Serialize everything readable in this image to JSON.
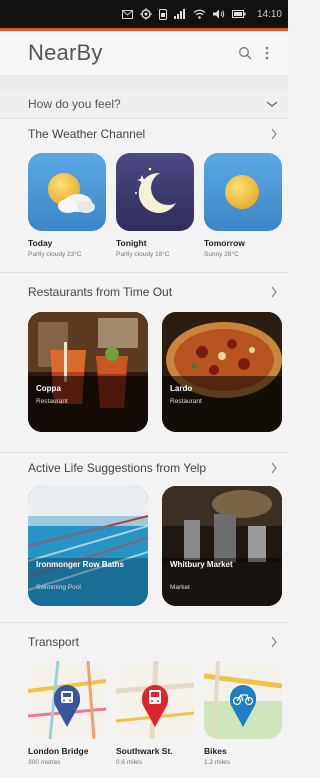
{
  "status_bar": {
    "time": "14:10",
    "icons": [
      "message-icon",
      "location-icon",
      "sim-icon",
      "signal-icon",
      "wifi-icon",
      "volume-icon",
      "battery-icon"
    ]
  },
  "header": {
    "title": "NearBy",
    "icons": [
      "search-icon",
      "menu-icon"
    ]
  },
  "feel": {
    "label": "How do you feel?"
  },
  "sections": {
    "weather": {
      "title": "The Weather Channel",
      "items": [
        {
          "title": "Today",
          "subtitle": "Partly cloudy 23°C"
        },
        {
          "title": "Tonight",
          "subtitle": "Partly cloudy 18°C"
        },
        {
          "title": "Tomorrow",
          "subtitle": "Sunny 28°C"
        }
      ]
    },
    "restaurants": {
      "title": "Restaurants from Time Out",
      "items": [
        {
          "title": "Coppa",
          "subtitle": "Restaurant"
        },
        {
          "title": "Lardo",
          "subtitle": "Restaurant"
        }
      ]
    },
    "active": {
      "title": "Active Life Suggestions from Yelp",
      "items": [
        {
          "title": "Ironmonger Row Baths",
          "subtitle": "Swimming Pool"
        },
        {
          "title": "Whitbury Market",
          "subtitle": "Market"
        }
      ]
    },
    "transport": {
      "title": "Transport",
      "items": [
        {
          "title": "London Bridge",
          "subtitle": "300 metres"
        },
        {
          "title": "Southwark St.",
          "subtitle": "0.6 miles"
        },
        {
          "title": "Bikes",
          "subtitle": "1.2 miles"
        }
      ]
    }
  },
  "colors": {
    "accent": "#e95420",
    "weather_sky": "#4d9fd9",
    "night": "#3b3a6e",
    "transport_pin": "#3a55a0",
    "bus_pin": "#d9262f",
    "bike_pin": "#1e7fc4"
  }
}
